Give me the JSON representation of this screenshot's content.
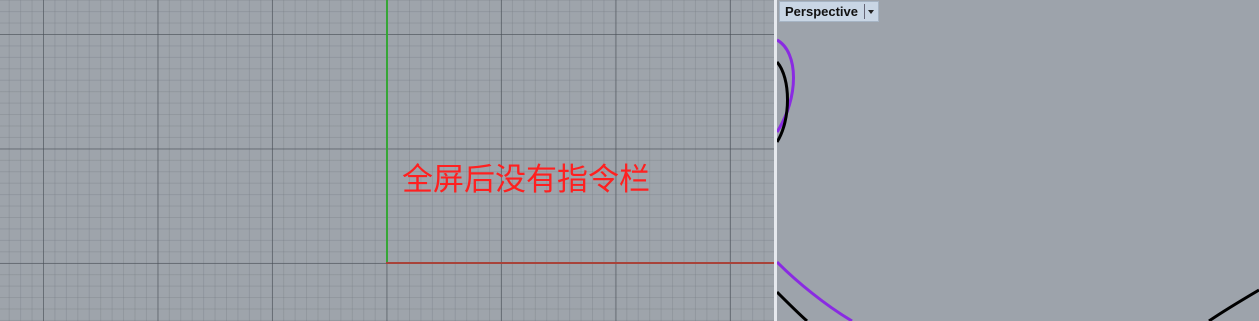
{
  "left_viewport": {
    "annotation_text": "全屏后没有指令栏"
  },
  "right_viewport": {
    "tab_label": "Perspective",
    "tab_menu_icon": "chevron-down-icon"
  },
  "colors": {
    "y_axis": "#36a636",
    "x_axis": "#a8433a",
    "annotation": "#ff2020",
    "curve_purple": "#8a2be2",
    "curve_black": "#000000"
  }
}
